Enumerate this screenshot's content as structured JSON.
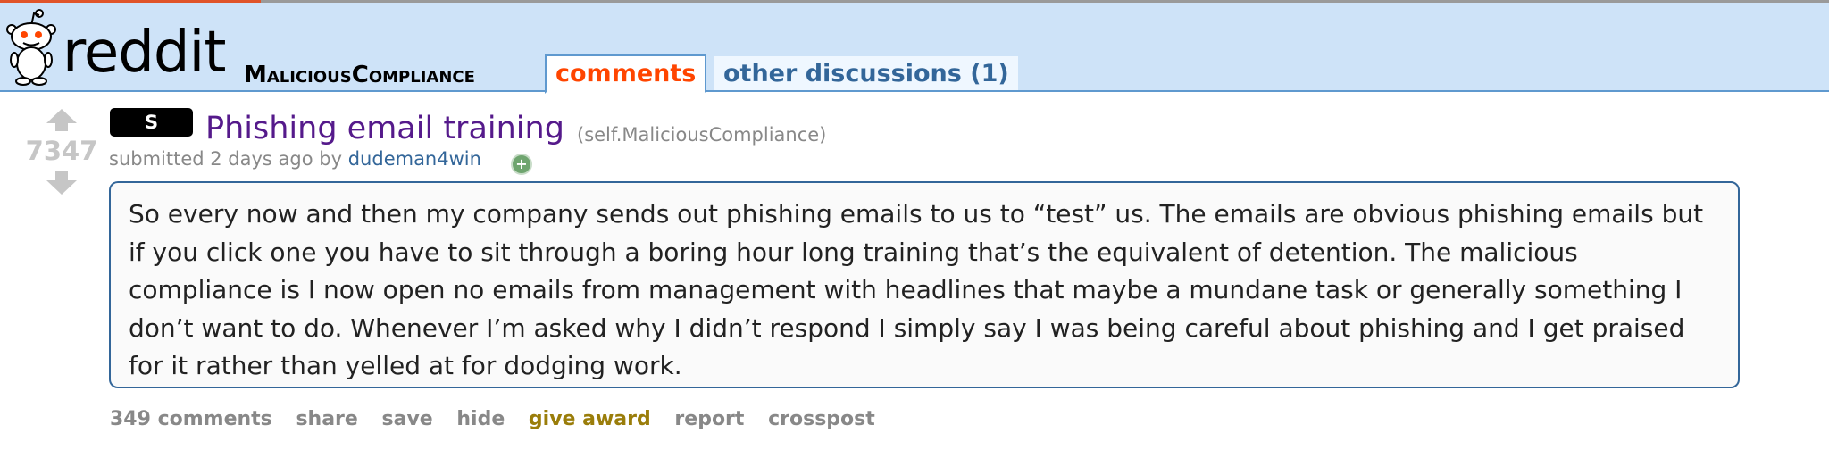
{
  "header": {
    "wordmark": "reddit",
    "subreddit": "MaliciousCompliance",
    "tabs": [
      {
        "label": "comments",
        "active": true
      },
      {
        "label": "other discussions (1)",
        "active": false
      }
    ]
  },
  "post": {
    "score": "7347",
    "flair": "S",
    "title": "Phishing email training",
    "domain": "(self.MaliciousCompliance)",
    "submitted_prefix": "submitted 2 days ago by",
    "author": "dudeman4win",
    "selftext": "So every now and then my company sends out phishing emails to us to “test” us. The emails are obvious phishing emails but if you click one you have to sit through a boring hour long training that’s the equivalent of detention. The malicious compliance is I now open no emails from management with headlines that maybe a mundane task or generally something I don’t want to do. Whenever I’m asked why I didn’t respond I simply say I was being careful about phishing and I get praised for it rather than yelled at for dodging work."
  },
  "actions": {
    "comments": "349 comments",
    "share": "share",
    "save": "save",
    "hide": "hide",
    "give_award": "give award",
    "report": "report",
    "crosspost": "crosspost"
  },
  "colors": {
    "header_bg": "#cee3f8",
    "active_tab": "#ff4500",
    "link_blue": "#336699",
    "title_visited": "#551a8b"
  }
}
